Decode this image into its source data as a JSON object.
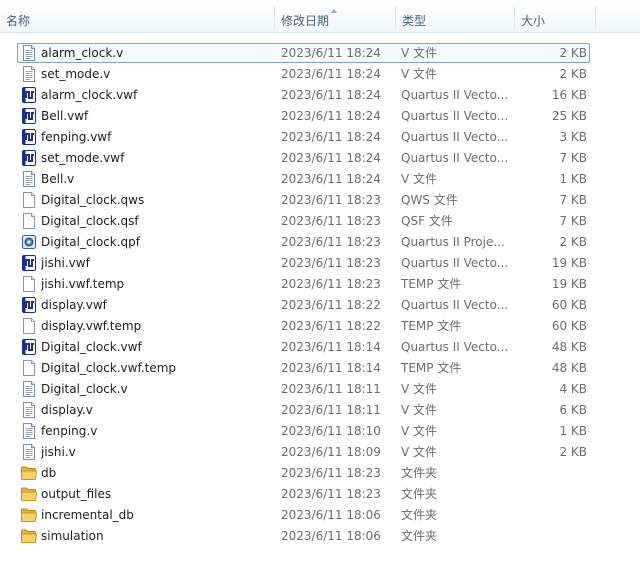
{
  "columns": {
    "name": "名称",
    "date": "修改日期",
    "type": "类型",
    "size": "大小"
  },
  "files": [
    {
      "name": "alarm_clock.v",
      "date": "2023/6/11 18:24",
      "type": "V 文件",
      "size": "2 KB",
      "icon": "text-file-icon",
      "selected": true
    },
    {
      "name": "set_mode.v",
      "date": "2023/6/11 18:24",
      "type": "V 文件",
      "size": "2 KB",
      "icon": "text-file-icon"
    },
    {
      "name": "alarm_clock.vwf",
      "date": "2023/6/11 18:24",
      "type": "Quartus II Vecto...",
      "size": "16 KB",
      "icon": "vwf-file-icon"
    },
    {
      "name": "Bell.vwf",
      "date": "2023/6/11 18:24",
      "type": "Quartus II Vecto...",
      "size": "25 KB",
      "icon": "vwf-file-icon"
    },
    {
      "name": "fenping.vwf",
      "date": "2023/6/11 18:24",
      "type": "Quartus II Vecto...",
      "size": "3 KB",
      "icon": "vwf-file-icon"
    },
    {
      "name": "set_mode.vwf",
      "date": "2023/6/11 18:24",
      "type": "Quartus II Vecto...",
      "size": "7 KB",
      "icon": "vwf-file-icon"
    },
    {
      "name": "Bell.v",
      "date": "2023/6/11 18:24",
      "type": "V 文件",
      "size": "1 KB",
      "icon": "text-file-icon"
    },
    {
      "name": "Digital_clock.qws",
      "date": "2023/6/11 18:23",
      "type": "QWS 文件",
      "size": "7 KB",
      "icon": "blank-file-icon"
    },
    {
      "name": "Digital_clock.qsf",
      "date": "2023/6/11 18:23",
      "type": "QSF 文件",
      "size": "7 KB",
      "icon": "blank-file-icon"
    },
    {
      "name": "Digital_clock.qpf",
      "date": "2023/6/11 18:23",
      "type": "Quartus II Proje...",
      "size": "2 KB",
      "icon": "qpf-file-icon"
    },
    {
      "name": "jishi.vwf",
      "date": "2023/6/11 18:23",
      "type": "Quartus II Vecto...",
      "size": "19 KB",
      "icon": "vwf-file-icon"
    },
    {
      "name": "jishi.vwf.temp",
      "date": "2023/6/11 18:23",
      "type": "TEMP 文件",
      "size": "19 KB",
      "icon": "blank-file-icon"
    },
    {
      "name": "display.vwf",
      "date": "2023/6/11 18:22",
      "type": "Quartus II Vecto...",
      "size": "60 KB",
      "icon": "vwf-file-icon"
    },
    {
      "name": "display.vwf.temp",
      "date": "2023/6/11 18:22",
      "type": "TEMP 文件",
      "size": "60 KB",
      "icon": "blank-file-icon"
    },
    {
      "name": "Digital_clock.vwf",
      "date": "2023/6/11 18:14",
      "type": "Quartus II Vecto...",
      "size": "48 KB",
      "icon": "vwf-file-icon"
    },
    {
      "name": "Digital_clock.vwf.temp",
      "date": "2023/6/11 18:14",
      "type": "TEMP 文件",
      "size": "48 KB",
      "icon": "blank-file-icon"
    },
    {
      "name": "Digital_clock.v",
      "date": "2023/6/11 18:11",
      "type": "V 文件",
      "size": "4 KB",
      "icon": "text-file-icon"
    },
    {
      "name": "display.v",
      "date": "2023/6/11 18:11",
      "type": "V 文件",
      "size": "6 KB",
      "icon": "text-file-icon"
    },
    {
      "name": "fenping.v",
      "date": "2023/6/11 18:10",
      "type": "V 文件",
      "size": "1 KB",
      "icon": "text-file-icon"
    },
    {
      "name": "jishi.v",
      "date": "2023/6/11 18:09",
      "type": "V 文件",
      "size": "2 KB",
      "icon": "text-file-icon"
    },
    {
      "name": "db",
      "date": "2023/6/11 18:23",
      "type": "文件夹",
      "size": "",
      "icon": "folder-icon"
    },
    {
      "name": "output_files",
      "date": "2023/6/11 18:23",
      "type": "文件夹",
      "size": "",
      "icon": "folder-icon"
    },
    {
      "name": "incremental_db",
      "date": "2023/6/11 18:06",
      "type": "文件夹",
      "size": "",
      "icon": "folder-icon"
    },
    {
      "name": "simulation",
      "date": "2023/6/11 18:06",
      "type": "文件夹",
      "size": "",
      "icon": "folder-icon"
    }
  ]
}
